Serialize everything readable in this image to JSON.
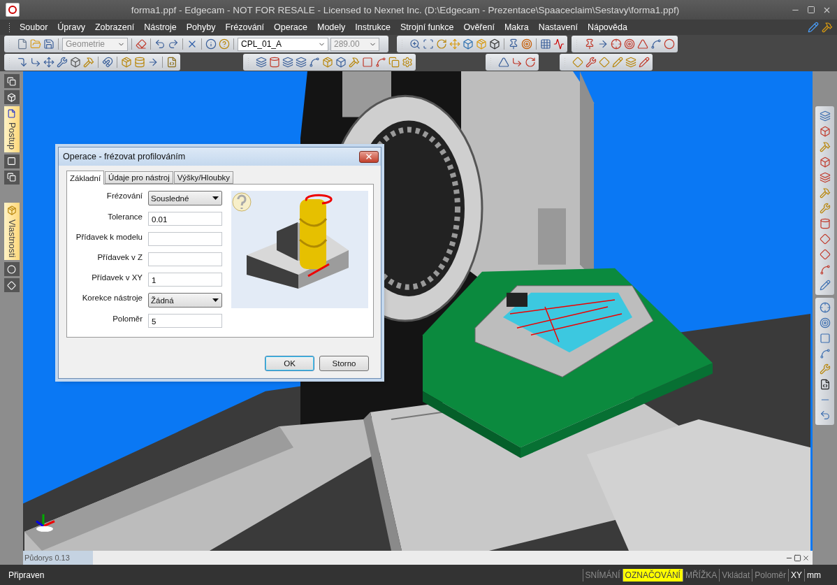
{
  "window": {
    "title": "forma1.ppf - Edgecam - NOT FOR RESALE - Licensed to Nexnet Inc. (D:\\Edgecam - Prezentace\\Spaaceclaim\\Sestavy\\forma1.ppf)"
  },
  "menu": [
    "Soubor",
    "Úpravy",
    "Zobrazení",
    "Nástroje",
    "Pohyby",
    "Frézování",
    "Operace",
    "Modely",
    "Instrukce",
    "Strojní funkce",
    "Ověření",
    "Makra",
    "Nastavení",
    "Nápověda"
  ],
  "toolbar": {
    "fields": [
      {
        "value": "Geometrie",
        "disabled": true
      },
      {
        "value": "CPL_01_A",
        "disabled": false
      },
      {
        "value": "289.00",
        "disabled": true
      }
    ]
  },
  "side_tabs": [
    "Postup",
    "Vlastnosti"
  ],
  "viewport": {
    "view_label": "Půdorys 0.13"
  },
  "dialog": {
    "title": "Operace - frézovat profilováním",
    "tabs": [
      {
        "label": "Základní",
        "selected": true
      },
      {
        "label": "Údaje pro nástroj",
        "selected": false
      },
      {
        "label": "Výšky/Hloubky",
        "selected": false
      }
    ],
    "fields": [
      {
        "label": "Frézování",
        "kind": "select",
        "value": "Sousledné"
      },
      {
        "label": "Tolerance",
        "kind": "input",
        "value": "0.01"
      },
      {
        "label": "Přídavek k modelu",
        "kind": "input"
      },
      {
        "label": "Přídavek v Z",
        "kind": "input"
      },
      {
        "label": "Přídavek v XY",
        "kind": "input",
        "value": "1"
      },
      {
        "label": "Korekce nástroje",
        "kind": "select",
        "value": "Žádná"
      },
      {
        "label": "Poloměr",
        "kind": "input",
        "value": "5"
      }
    ],
    "buttons": [
      {
        "label": "OK",
        "default": true
      },
      {
        "label": "Storno",
        "default": false
      }
    ]
  },
  "status_bar": {
    "message": "Připraven",
    "indicators": [
      {
        "label": "SNÍMÁNÍ",
        "on": false,
        "highlighted": false
      },
      {
        "label": "OZNAČOVÁNÍ",
        "on": true,
        "highlighted": true
      },
      {
        "label": "MŘÍŽKA",
        "on": false,
        "highlighted": false
      },
      {
        "label": "Vkládat",
        "on": false,
        "highlighted": false
      },
      {
        "label": "Poloměr",
        "on": false,
        "highlighted": false
      },
      {
        "label": "XY",
        "on": true,
        "highlighted": false
      },
      {
        "label": "mm",
        "on": true,
        "highlighted": false
      }
    ]
  }
}
